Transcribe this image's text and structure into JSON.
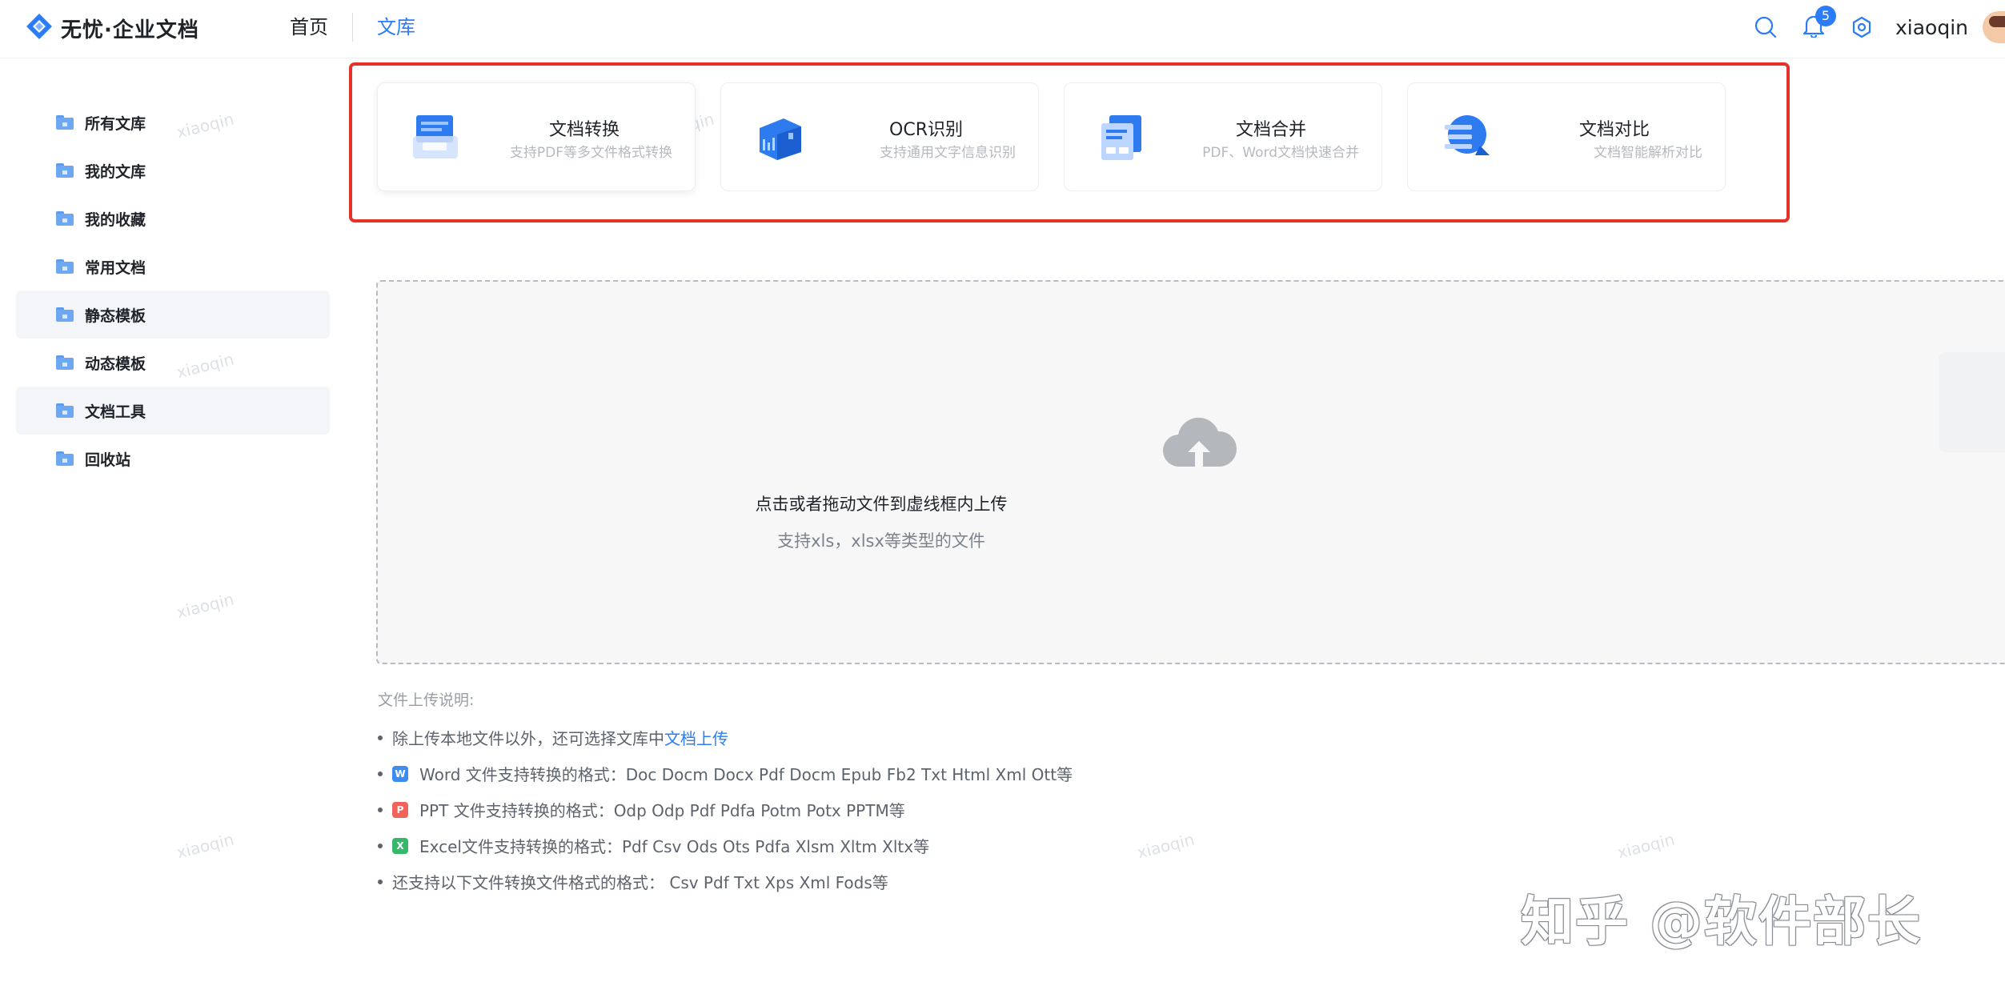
{
  "header": {
    "logo_text": "无忧·企业文档",
    "nav": [
      {
        "label": "首页",
        "active": false
      },
      {
        "label": "文库",
        "active": true
      }
    ],
    "notification_count": "5",
    "username": "xiaoqin",
    "icons": [
      "search-icon",
      "bell-icon",
      "settings-gear-icon",
      "avatar"
    ]
  },
  "sidebar": {
    "items": [
      {
        "label": "所有文库",
        "highlighted": false
      },
      {
        "label": "我的文库",
        "highlighted": false
      },
      {
        "label": "我的收藏",
        "highlighted": false
      },
      {
        "label": "常用文档",
        "highlighted": false
      },
      {
        "label": "静态模板",
        "highlighted": true
      },
      {
        "label": "动态模板",
        "highlighted": false
      },
      {
        "label": "文档工具",
        "highlighted": true
      },
      {
        "label": "回收站",
        "highlighted": false
      }
    ]
  },
  "tools": [
    {
      "title": "文档转换",
      "desc": "支持PDF等多文件格式转换",
      "icon": "doc-convert-icon"
    },
    {
      "title": "OCR识别",
      "desc": "支持通用文字信息识别",
      "icon": "ocr-icon"
    },
    {
      "title": "文档合并",
      "desc": "PDF、Word文档快速合并",
      "icon": "doc-merge-icon"
    },
    {
      "title": "文档对比",
      "desc": "文档智能解析对比",
      "icon": "doc-compare-icon"
    }
  ],
  "upload": {
    "main_text": "点击或者拖动文件到虚线框内上传",
    "sub_text": "支持xls，xlsx等类型的文件"
  },
  "notes": {
    "title": "文件上传说明:",
    "line1_text": "除上传本地文件以外，还可选择文库中",
    "line1_link": "文档上传",
    "word": "Word 文件支持转换的格式：Doc Docm Docx Pdf Docm Epub Fb2 Txt Html Xml Ott等",
    "ppt": "PPT 文件支持转换的格式：Odp Odp Pdf Pdfa Potm Potx PPTM等",
    "excel": "Excel文件支持转换的格式：Pdf Csv Ods Ots Pdfa Xlsm Xltm Xltx等",
    "other": "还支持以下文件转换文件格式的格式：  Csv Pdf Txt Xps Xml Fods等",
    "word_badge": "W",
    "ppt_badge": "P",
    "excel_badge": "X"
  },
  "watermark_text": "xiaoqin",
  "corner_watermark": "知乎 @软件部长",
  "colors": {
    "accent": "#2b7cf6",
    "highlight_frame": "#e5332a",
    "word": "#3b8df1",
    "ppt": "#f0625a",
    "excel": "#35b86a"
  }
}
